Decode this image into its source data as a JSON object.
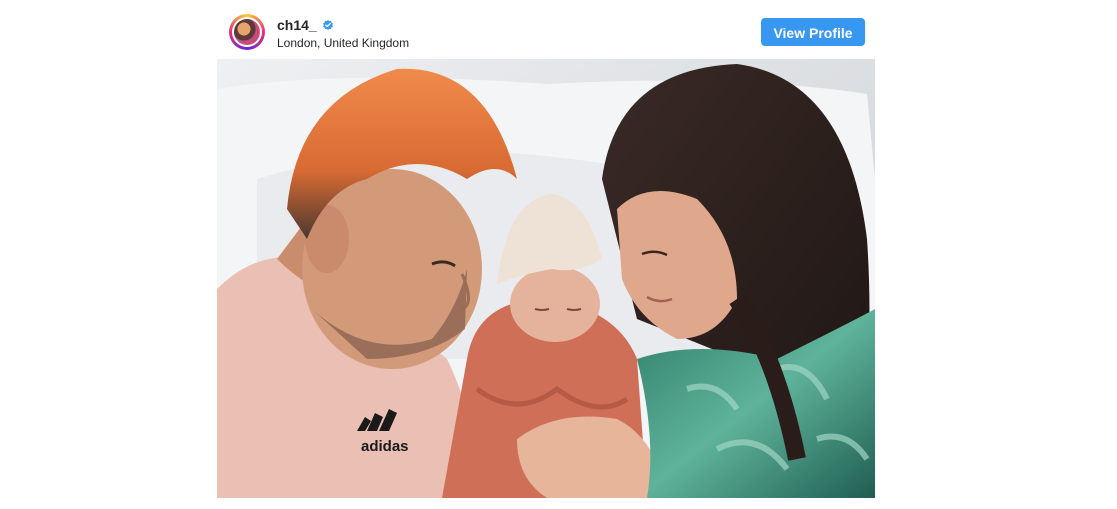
{
  "post": {
    "username": "ch14_",
    "location": "London, United Kingdom",
    "view_profile_label": "View Profile",
    "verified": true
  },
  "photo": {
    "shirt_brand": "adidas",
    "description_icon": "post-photo"
  },
  "colors": {
    "button": "#3897f0",
    "verified_badge": "#3897f0",
    "text": "#262626"
  }
}
